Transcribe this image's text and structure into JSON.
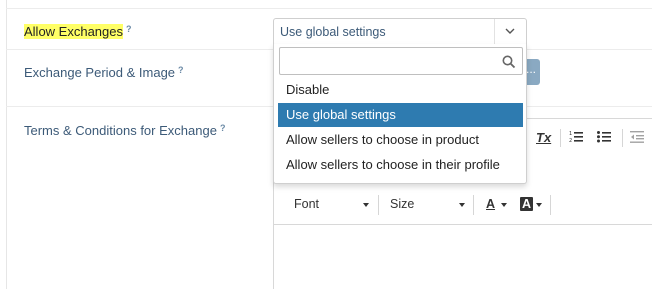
{
  "fields": {
    "allow_exchanges": {
      "label": "Allow Exchanges",
      "help": "?"
    },
    "exchange_period": {
      "label": "Exchange Period & Image",
      "help": "?"
    },
    "terms": {
      "label": "Terms & Conditions for Exchange",
      "help": "?"
    }
  },
  "select": {
    "value": "Use global settings",
    "search_placeholder": "",
    "options": [
      {
        "label": "Disable",
        "selected": false
      },
      {
        "label": "Use global settings",
        "selected": true
      },
      {
        "label": "Allow sellers to choose in product",
        "selected": false
      },
      {
        "label": "Allow sellers to choose in their profile",
        "selected": false
      }
    ]
  },
  "side_button": {
    "label": "..."
  },
  "editor": {
    "font_combo": "Font",
    "size_combo": "Size",
    "text_color_glyph": "A",
    "bg_color_glyph": "A",
    "clear_format_glyph": "Tx"
  },
  "colors": {
    "highlight": "#ffff66",
    "selected_option": "#2e7bb0",
    "label_text": "#3c5a78"
  }
}
